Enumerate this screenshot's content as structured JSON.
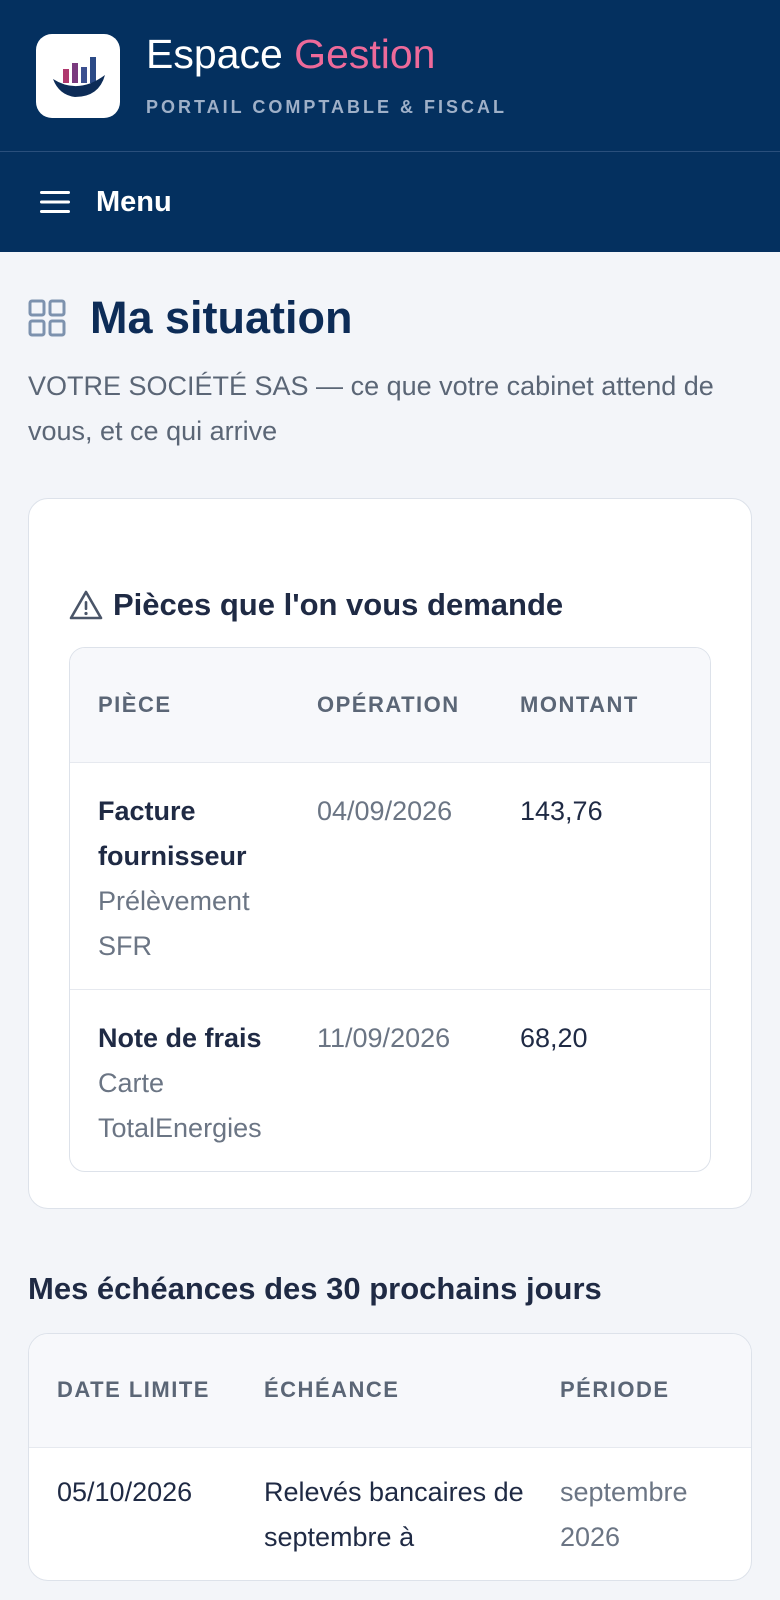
{
  "header": {
    "brand_main": "Espace",
    "brand_accent": "Gestion",
    "brand_subtitle": "PORTAIL COMPTABLE & FISCAL",
    "menu_label": "Menu"
  },
  "colors": {
    "navy": "#04305f",
    "accent_pink": "#ee6a9a"
  },
  "page": {
    "title": "Ma situation",
    "subtitle": "VOTRE SOCIÉTÉ SAS — ce que votre cabinet attend de vous, et ce qui arrive"
  },
  "pieces": {
    "title": "Pièces que l'on vous demande",
    "columns": [
      "PIÈCE",
      "OPÉRATION",
      "MONTANT"
    ],
    "rows": [
      {
        "piece": "Facture fournisseur",
        "detail": "Prélèvement SFR",
        "date": "04/09/2026",
        "amount": "143,76"
      },
      {
        "piece": "Note de frais",
        "detail": "Carte TotalEnergies",
        "date": "11/09/2026",
        "amount": "68,20"
      }
    ]
  },
  "echeances": {
    "title": "Mes échéances des 30 prochains jours",
    "columns": [
      "DATE LIMITE",
      "ÉCHÉANCE",
      "PÉRIODE"
    ],
    "rows": [
      {
        "date": "05/10/2026",
        "label": "Relevés bancaires de septembre à",
        "period": "septembre 2026"
      }
    ]
  }
}
